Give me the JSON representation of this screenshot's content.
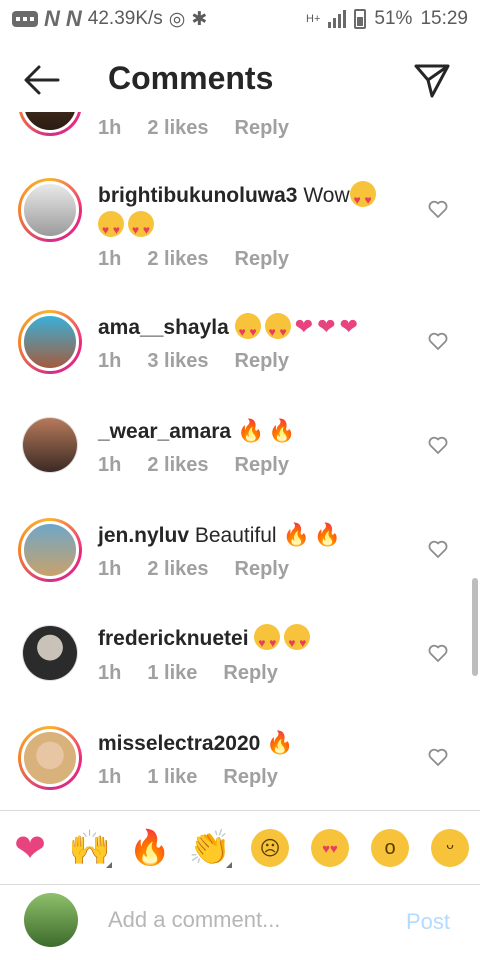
{
  "status_bar": {
    "speed": "42.39K/s",
    "network": "H+",
    "battery": "51%",
    "time": "15:29"
  },
  "header": {
    "title": "Comments"
  },
  "comments": [
    {
      "username": "",
      "text": "",
      "time": "1h",
      "likes": "2 likes",
      "reply": "Reply",
      "emoji": []
    },
    {
      "username": "brightibukunoluwa3",
      "text": "Wow",
      "time": "1h",
      "likes": "2 likes",
      "reply": "Reply",
      "emoji": [
        "heart-eyes-emoji",
        "heart-eyes-emoji",
        "heart-eyes-emoji"
      ]
    },
    {
      "username": "ama__shayla",
      "text": "",
      "time": "1h",
      "likes": "3 likes",
      "reply": "Reply",
      "emoji": [
        "heart-eyes-emoji",
        "heart-eyes-emoji",
        "pink-heart-emoji",
        "pink-heart-emoji",
        "pink-heart-emoji"
      ]
    },
    {
      "username": "_wear_amara",
      "text": "",
      "time": "1h",
      "likes": "2 likes",
      "reply": "Reply",
      "emoji": [
        "fire-emoji",
        "fire-emoji"
      ]
    },
    {
      "username": "jen.nyluv",
      "text": "Beautiful",
      "time": "1h",
      "likes": "2 likes",
      "reply": "Reply",
      "emoji": [
        "fire-emoji",
        "fire-emoji"
      ]
    },
    {
      "username": "fredericknuetei",
      "text": "",
      "time": "1h",
      "likes": "1 like",
      "reply": "Reply",
      "emoji": [
        "heart-eyes-emoji",
        "heart-eyes-emoji"
      ]
    },
    {
      "username": "misselectra2020",
      "text": "",
      "time": "1h",
      "likes": "1 like",
      "reply": "Reply",
      "emoji": [
        "fire-emoji"
      ]
    }
  ],
  "reactions": [
    "red-heart",
    "raising-hands",
    "fire",
    "clapping-hands",
    "sad-face",
    "heart-eyes",
    "surprised-face",
    "grinning-face"
  ],
  "composer": {
    "placeholder": "Add a comment...",
    "post_label": "Post"
  },
  "colors": {
    "accent": "#3897f0",
    "post_disabled": "#b3dbff",
    "muted": "#a0a0a0",
    "story_ring": "#ee2a7b"
  }
}
